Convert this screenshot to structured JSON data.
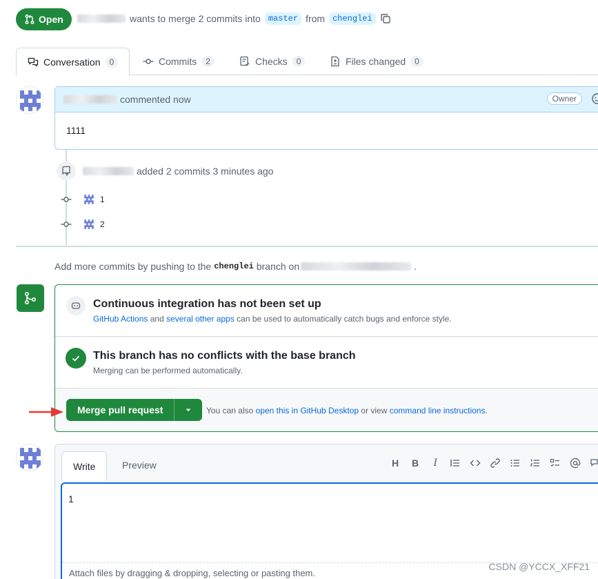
{
  "header": {
    "state": "Open",
    "action_text": "wants to merge 2 commits into",
    "base_branch": "master",
    "from_text": "from",
    "head_branch": "chenglei"
  },
  "tabs": [
    {
      "label": "Conversation",
      "count": "0"
    },
    {
      "label": "Commits",
      "count": "2"
    },
    {
      "label": "Checks",
      "count": "0"
    },
    {
      "label": "Files changed",
      "count": "0"
    }
  ],
  "comment": {
    "meta": "commented now",
    "badge": "Owner",
    "body": "1111"
  },
  "commits_event": {
    "text": "added 2 commits 3 minutes ago",
    "commits": [
      "1",
      "2"
    ]
  },
  "hint": {
    "prefix": "Add more commits by pushing to the",
    "branch": "chenglei",
    "suffix": "branch on",
    "end": "."
  },
  "mergebox": {
    "ci_title": "Continuous integration has not been set up",
    "ci_link1": "GitHub Actions",
    "ci_and": "and",
    "ci_link2": "several other apps",
    "ci_rest": "can be used to automatically catch bugs and enforce style.",
    "conflict_title": "This branch has no conflicts with the base branch",
    "conflict_sub": "Merging can be performed automatically.",
    "merge_button": "Merge pull request",
    "also_text": "You can also",
    "desktop_link": "open this in GitHub Desktop",
    "or_view": "or view",
    "cli_link": "command line instructions",
    "period": "."
  },
  "editor": {
    "tab_write": "Write",
    "tab_preview": "Preview",
    "value": "1",
    "attach_hint": "Attach files by dragging & dropping, selecting or pasting them."
  },
  "watermark": "CSDN @YCCX_XFF21",
  "colors": {
    "success": "#1f883d",
    "accent": "#0969da",
    "arrow": "#e53935"
  }
}
